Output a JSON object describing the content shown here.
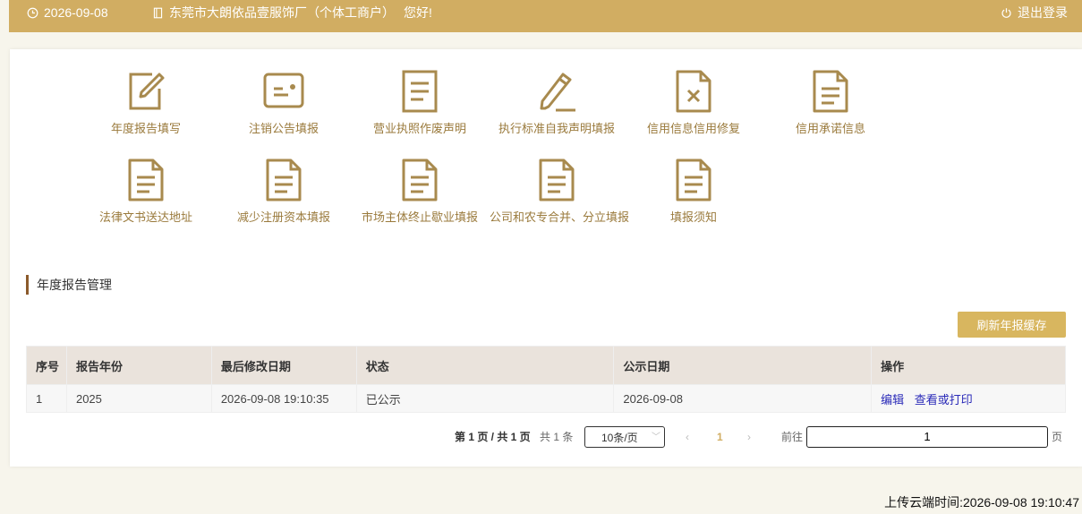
{
  "topbar": {
    "date": "2026-09-08",
    "company": "东莞市大朗依品壹服饰厂（个体工商户）",
    "hello": "您好!",
    "logout": "退出登录"
  },
  "menu": [
    {
      "label": "年度报告填写",
      "icon": "edit-icon"
    },
    {
      "label": "注销公告填报",
      "icon": "id-card-icon"
    },
    {
      "label": "营业执照作废声明",
      "icon": "document-icon"
    },
    {
      "label": "执行标准自我声明填报",
      "icon": "pen-icon"
    },
    {
      "label": "信用信息信用修复",
      "icon": "document-x-icon"
    },
    {
      "label": "信用承诺信息",
      "icon": "document-icon"
    },
    {
      "label": "法律文书送达地址",
      "icon": "document-icon"
    },
    {
      "label": "减少注册资本填报",
      "icon": "document-icon"
    },
    {
      "label": "市场主体终止歇业填报",
      "icon": "document-icon"
    },
    {
      "label": "公司和农专合并、分立填报",
      "icon": "document-icon"
    },
    {
      "label": "填报须知",
      "icon": "document-icon"
    }
  ],
  "section": {
    "title": "年度报告管理"
  },
  "refresh_button": "刷新年报缓存",
  "table": {
    "headers": [
      "序号",
      "报告年份",
      "最后修改日期",
      "状态",
      "公示日期",
      "操作"
    ],
    "rows": [
      {
        "index": "1",
        "year": "2025",
        "modified": "2026-09-08 19:10:35",
        "status": "已公示",
        "publish_date": "2026-09-08",
        "op_edit": "编辑",
        "op_view": "查看或打印"
      }
    ]
  },
  "pagination": {
    "info": "第 1 页 / 共 1 页",
    "total": "共 1 条",
    "page_size": "10条/页",
    "prev": "‹",
    "current_page": "1",
    "next": "›",
    "goto_label": "前往",
    "goto_value": "1",
    "goto_unit": "页"
  },
  "upload_time": "上传云端时间:2026-09-08 19:10:47",
  "colors": {
    "accent": "#d1ad62",
    "icon": "#a88a4e",
    "link": "#2a2ab8"
  }
}
